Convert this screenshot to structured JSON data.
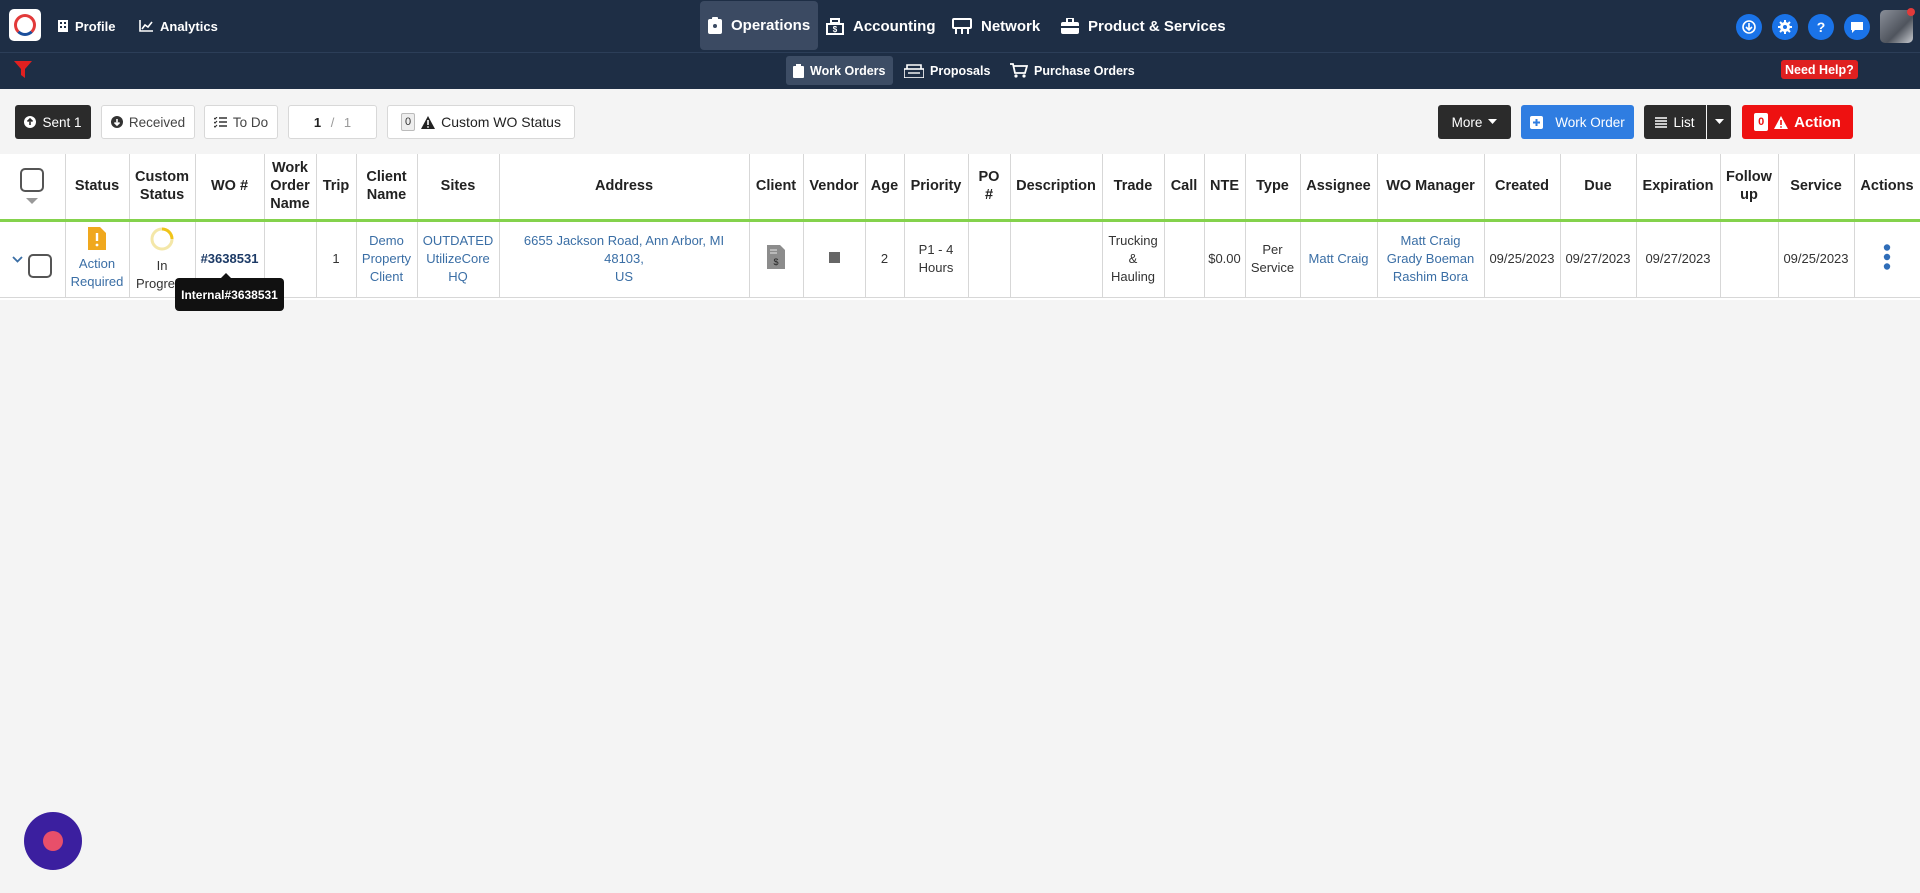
{
  "topnav": {
    "profile": "Profile",
    "analytics": "Analytics",
    "operations": "Operations",
    "accounting": "Accounting",
    "network": "Network",
    "product_services": "Product & Services"
  },
  "subnav": {
    "work_orders": "Work Orders",
    "proposals": "Proposals",
    "purchase_orders": "Purchase Orders",
    "need_help": "Need Help?"
  },
  "toolbar": {
    "sent": "Sent 1",
    "received": "Received",
    "todo": "To Do",
    "page_current": "1",
    "page_sep": " / ",
    "page_total": "1",
    "status_count": "0",
    "custom_status": "Custom WO Status",
    "more": "More",
    "work_order": "Work Order",
    "list": "List",
    "action_count": "0",
    "action": "Action"
  },
  "table": {
    "headers": {
      "status": "Status",
      "custom_status_1": "Custom",
      "custom_status_2": "Status",
      "wo": "WO #",
      "wo_name_1": "Work",
      "wo_name_2": "Order",
      "wo_name_3": "Name",
      "trip": "Trip",
      "client_name_1": "Client",
      "client_name_2": "Name",
      "sites": "Sites",
      "address": "Address",
      "client": "Client",
      "vendor": "Vendor",
      "age": "Age",
      "priority": "Priority",
      "po_1": "PO",
      "po_2": "#",
      "description": "Description",
      "trade": "Trade",
      "call": "Call",
      "nte": "NTE",
      "type": "Type",
      "assignee": "Assignee",
      "wo_manager": "WO Manager",
      "created": "Created",
      "due": "Due",
      "expiration": "Expiration",
      "follow_up_1": "Follow",
      "follow_up_2": "up",
      "service": "Service",
      "actions": "Actions"
    },
    "row": {
      "status_1": "Action",
      "status_2": "Required",
      "custom_status_1": "In",
      "custom_status_2": "Progress",
      "wo": "#3638531",
      "trip": "1",
      "client_name_1": "Demo",
      "client_name_2": "Property",
      "client_name_3": "Client",
      "sites_1": "OUTDATED",
      "sites_2": "UtilizeCore",
      "sites_3": "HQ",
      "address_1": "6655 Jackson Road, Ann Arbor, MI 48103,",
      "address_2": "US",
      "age": "2",
      "priority_1": "P1 - 4",
      "priority_2": "Hours",
      "trade_1": "Trucking",
      "trade_2": "&",
      "trade_3": "Hauling",
      "nte": "$0.00",
      "type_1": "Per",
      "type_2": "Service",
      "assignee": "Matt Craig",
      "manager_1": "Matt Craig",
      "manager_2": "Grady Boeman",
      "manager_3": "Rashim Bora",
      "created": "09/25/2023",
      "due": "09/27/2023",
      "expiration": "09/27/2023",
      "service": "09/25/2023"
    }
  },
  "tooltip": "Internal#3638531",
  "colors": {
    "nav_bg": "#1e2e45",
    "accent_blue": "#2f7de1",
    "action_red": "#ee1111",
    "header_underline": "#84d24c",
    "link": "#3a6ea5",
    "warning": "#f0a81e"
  }
}
